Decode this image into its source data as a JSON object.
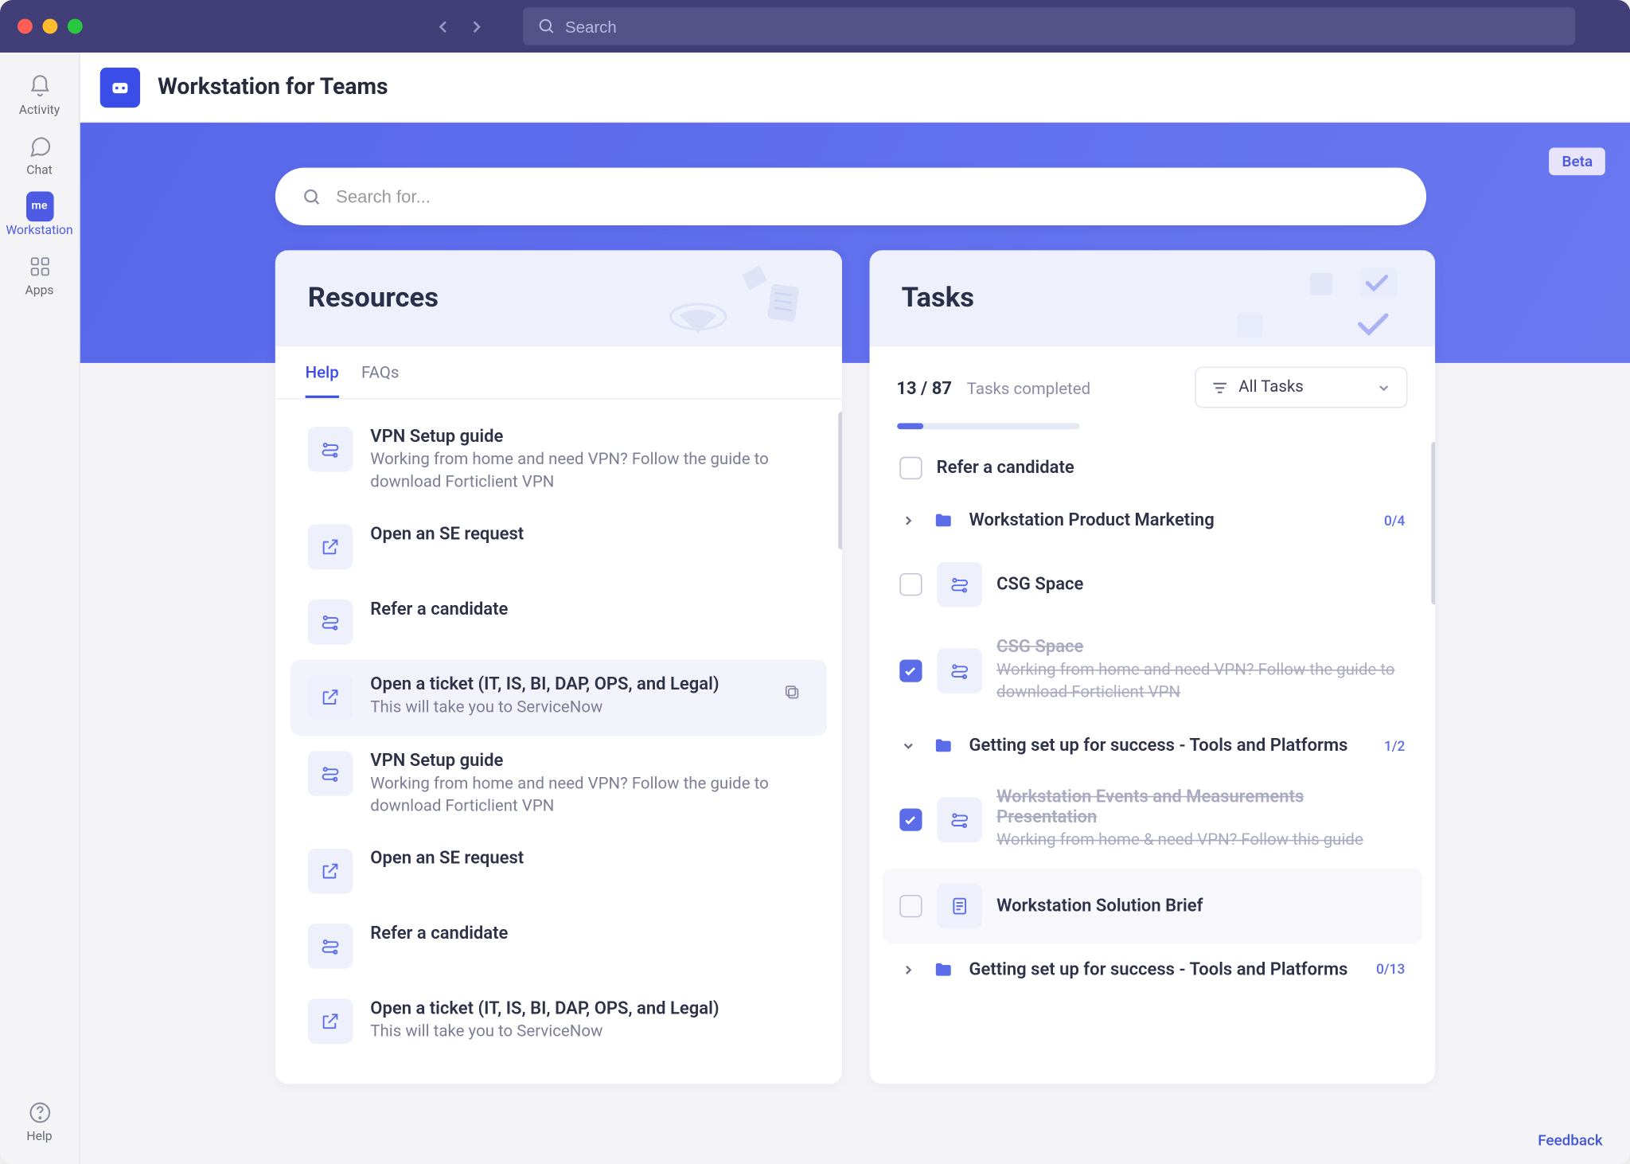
{
  "top": {
    "search_placeholder": "Search"
  },
  "rail": {
    "activity": "Activity",
    "chat": "Chat",
    "workstation": "Workstation",
    "apps": "Apps",
    "help": "Help"
  },
  "app": {
    "logo_text": "me",
    "title": "Workstation for Teams",
    "beta": "Beta",
    "search_placeholder": "Search for...",
    "feedback": "Feedback"
  },
  "resources": {
    "heading": "Resources",
    "tabs": {
      "help": "Help",
      "faqs": "FAQs"
    },
    "items": [
      {
        "title": "VPN Setup guide",
        "desc": "Working from home and need VPN? Follow the guide to download Forticlient VPN",
        "icon": "route"
      },
      {
        "title": "Open an SE request",
        "desc": "",
        "icon": "external"
      },
      {
        "title": "Refer a candidate",
        "desc": "",
        "icon": "route"
      },
      {
        "title": "Open a ticket (IT, IS, BI, DAP, OPS, and Legal)",
        "desc": "This will take you to ServiceNow",
        "icon": "external",
        "hovered": true
      },
      {
        "title": "VPN Setup guide",
        "desc": "Working from home and need VPN? Follow the guide to download Forticlient VPN",
        "icon": "route"
      },
      {
        "title": "Open an SE request",
        "desc": "",
        "icon": "external"
      },
      {
        "title": "Refer a candidate",
        "desc": "",
        "icon": "route"
      },
      {
        "title": "Open a ticket (IT, IS, BI, DAP, OPS, and Legal)",
        "desc": "This will take you to ServiceNow",
        "icon": "external"
      }
    ]
  },
  "tasks": {
    "heading": "Tasks",
    "count": "13 / 87",
    "count_label": "Tasks completed",
    "progress_pct": 15,
    "filter": "All Tasks",
    "items": [
      {
        "kind": "check",
        "checked": false,
        "title": "Refer a candidate"
      },
      {
        "kind": "folder",
        "expanded": false,
        "title": "Workstation Product Marketing",
        "badge": "0/4"
      },
      {
        "kind": "doc",
        "checked": false,
        "title": "CSG Space"
      },
      {
        "kind": "doc",
        "checked": true,
        "strike": true,
        "title": "CSG Space",
        "desc": "Working from home and need VPN? Follow the guide to download Forticlient VPN"
      },
      {
        "kind": "folder",
        "expanded": true,
        "title": "Getting set up for success - Tools and Platforms",
        "badge": "1/2"
      },
      {
        "kind": "doc",
        "checked": true,
        "strike": true,
        "title": "Workstation Events and Measurements Presentation",
        "desc": "Working from home & need VPN? Follow this guide"
      },
      {
        "kind": "doc",
        "checked": false,
        "with_bg": true,
        "icon": "file",
        "title": "Workstation Solution Brief"
      },
      {
        "kind": "folder",
        "expanded": false,
        "title": "Getting set up for success - Tools and Platforms",
        "badge": "0/13"
      }
    ]
  }
}
